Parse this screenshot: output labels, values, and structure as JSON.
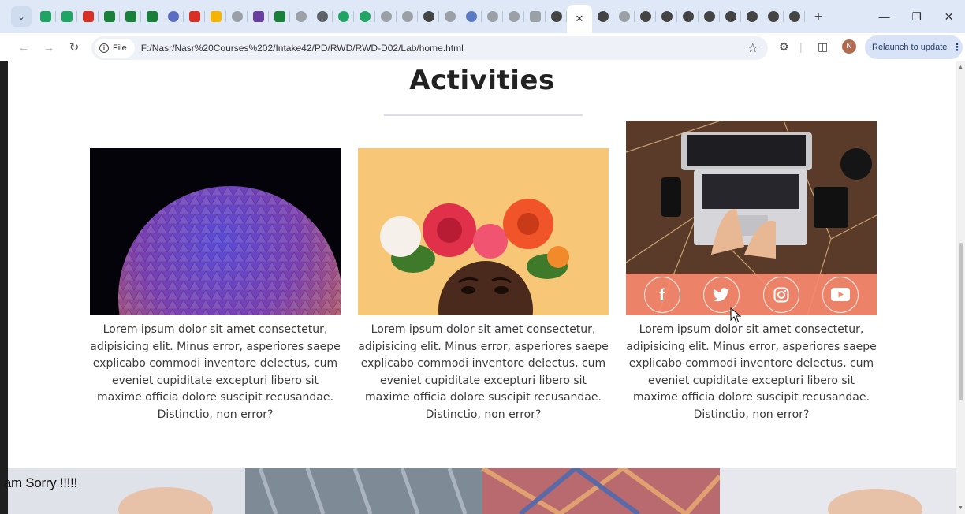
{
  "browser": {
    "tabs": [
      {
        "icon": "google-drive-icon",
        "color": "#1fa463"
      },
      {
        "icon": "google-drive-icon",
        "color": "#1fa463"
      },
      {
        "icon": "gmail-icon",
        "color": "#d93025"
      },
      {
        "icon": "google-sheets-icon",
        "color": "#188038"
      },
      {
        "icon": "google-sheets-icon",
        "color": "#188038"
      },
      {
        "icon": "google-sheets-icon",
        "color": "#188038"
      },
      {
        "icon": "site-icon",
        "color": "#5a6cc4"
      },
      {
        "icon": "gmail-icon",
        "color": "#d93025"
      },
      {
        "icon": "slides-icon",
        "color": "#f4b400"
      },
      {
        "icon": "site-icon",
        "color": "#9aa0a6"
      },
      {
        "icon": "mail-icon",
        "color": "#6b3fa0"
      },
      {
        "icon": "google-sheets-icon",
        "color": "#188038"
      },
      {
        "icon": "site-icon",
        "color": "#9aa0a6"
      },
      {
        "icon": "site-icon",
        "color": "#5f6368"
      },
      {
        "icon": "site-icon",
        "color": "#1fa463"
      },
      {
        "icon": "site-icon",
        "color": "#1fa463"
      },
      {
        "icon": "site-icon",
        "color": "#9aa0a6"
      },
      {
        "icon": "site-icon",
        "color": "#9aa0a6"
      },
      {
        "icon": "site-icon",
        "color": "#444444"
      },
      {
        "icon": "site-icon",
        "color": "#9aa0a6"
      },
      {
        "icon": "site-icon",
        "color": "#5a7ac4"
      },
      {
        "icon": "site-icon",
        "color": "#9aa0a6"
      },
      {
        "icon": "site-icon",
        "color": "#9aa0a6"
      },
      {
        "icon": "code-icon",
        "color": "#9aa0a6"
      },
      {
        "icon": "chrome-icon",
        "color": "#444444"
      }
    ],
    "tabs_after_active": [
      {
        "icon": "chrome-icon",
        "color": "#444444"
      },
      {
        "icon": "site-icon",
        "color": "#9aa0a6"
      },
      {
        "icon": "chrome-icon",
        "color": "#444444"
      },
      {
        "icon": "chrome-icon",
        "color": "#444444"
      },
      {
        "icon": "chrome-icon",
        "color": "#444444"
      },
      {
        "icon": "chrome-icon",
        "color": "#444444"
      },
      {
        "icon": "chrome-icon",
        "color": "#444444"
      },
      {
        "icon": "chrome-icon",
        "color": "#444444"
      },
      {
        "icon": "chrome-icon",
        "color": "#444444"
      },
      {
        "icon": "chrome-icon",
        "color": "#444444"
      }
    ],
    "active_tab_close": "✕",
    "new_tab": "+",
    "file_chip": "File",
    "url": "F:/Nasr/Nasr%20Courses%202/Intake42/PD/RWD/RWD-D02/Lab/home.html",
    "profile_initial": "N",
    "relaunch_label": "Relaunch to update"
  },
  "page": {
    "section_title": "Activities",
    "cards": [
      {
        "image": "epcot-sphere",
        "text": "Lorem ipsum dolor sit amet consectetur, adipisicing elit. Minus error, asperiores saepe explicabo commodi inventore delectus, cum eveniet cupiditate excepturi libero sit maxime officia dolore suscipit recusandae. Distinctio, non error?"
      },
      {
        "image": "flower-crown",
        "text": "Lorem ipsum dolor sit amet consectetur, adipisicing elit. Minus error, asperiores saepe explicabo commodi inventore delectus, cum eveniet cupiditate excepturi libero sit maxime officia dolore suscipit recusandae. Distinctio, non error?"
      },
      {
        "image": "laptop-desk",
        "text": "Lorem ipsum dolor sit amet consectetur, adipisicing elit. Minus error, asperiores saepe explicabo commodi inventore delectus, cum eveniet cupiditate excepturi libero sit maxime officia dolore suscipit recusandae. Distinctio, non error?"
      }
    ],
    "social_icons": [
      "facebook-icon",
      "twitter-icon",
      "instagram-icon",
      "youtube-icon"
    ],
    "social_bar_color": "#f88a6e"
  },
  "overlay_caption": "I am Sorry !!!!!"
}
